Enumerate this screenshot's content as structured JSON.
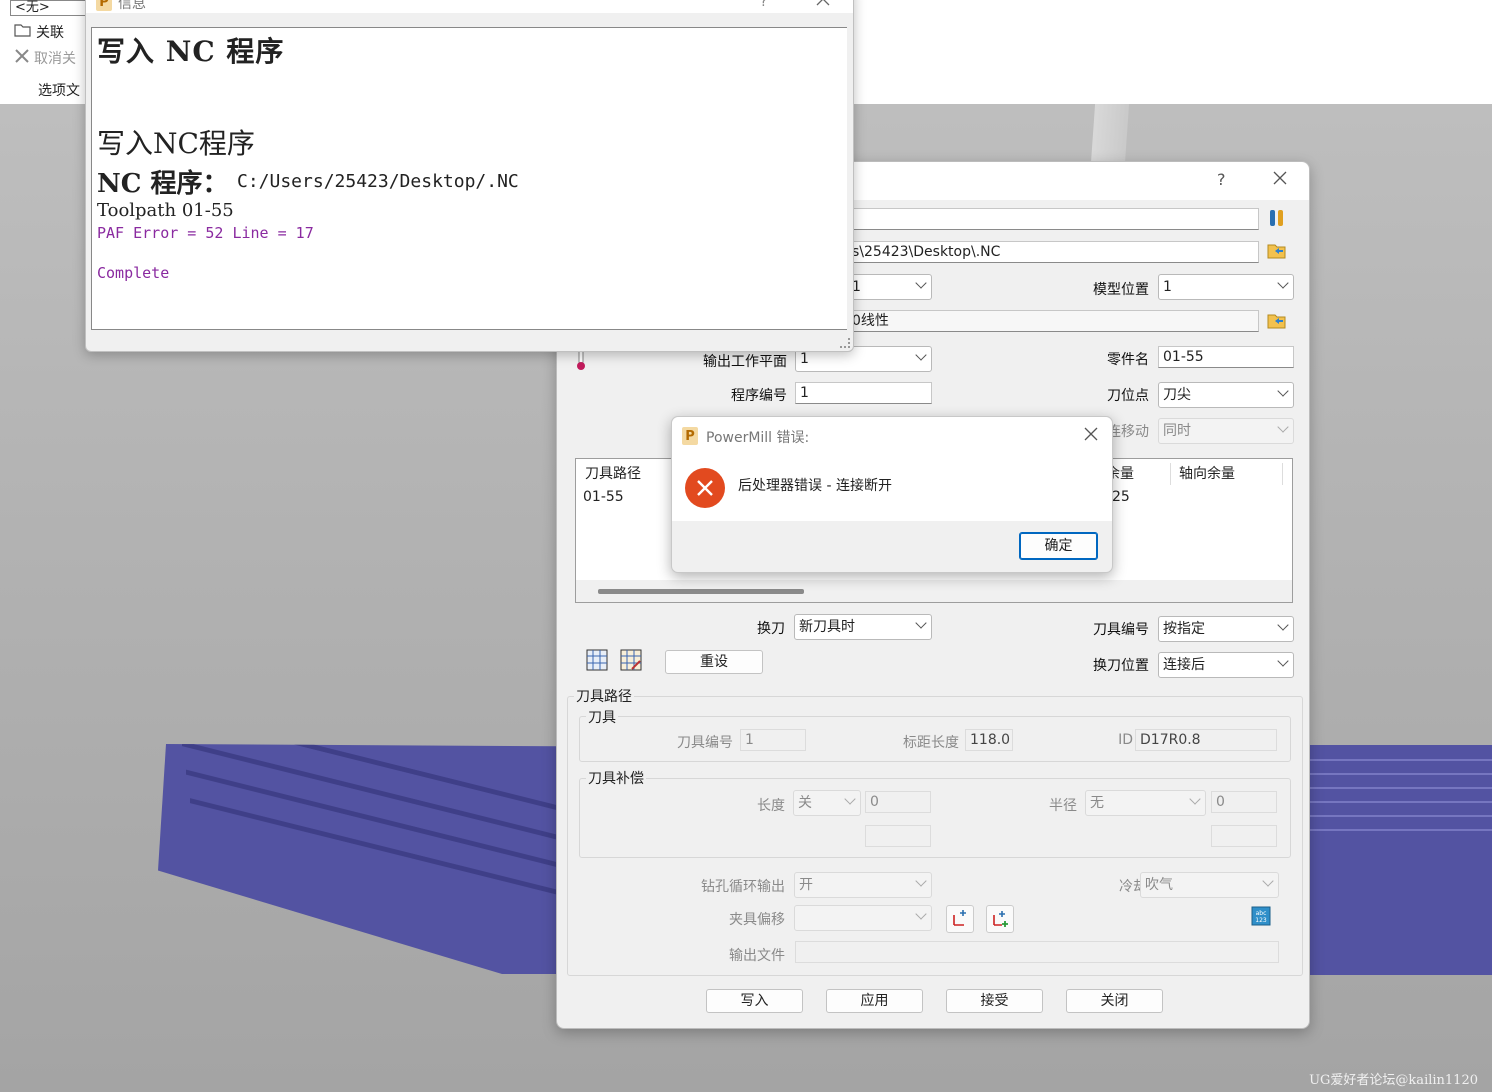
{
  "left_panel": {
    "selector": "<无>",
    "assoc": "关联",
    "unassoc": "取消关",
    "options": "选项文"
  },
  "watermark": "UG爱好者论坛@kailin1120",
  "info_window": {
    "title": "信息",
    "heading1": "写入 NC 程序",
    "heading2": "写入NC程序",
    "nc_label": "NC 程序：",
    "nc_path": "C:/Users/25423/Desktop/.NC",
    "toolpath": "Toolpath 01-55",
    "error_line": "PAF Error = 52 Line = 17",
    "complete": "Complete"
  },
  "nc_dialog": {
    "help": "?",
    "path_tail": "s\\25423\\Desktop\\.NC",
    "row3_value": "1",
    "model_pos_label": "模型位置",
    "model_pos_value": "1",
    "linear_tail": "0线性",
    "output_wp_label": "输出工作平面",
    "output_wp_value": "1",
    "part_name_label": "零件名",
    "part_name_value": "01-55",
    "program_no_label": "程序编号",
    "program_no_value": "1",
    "tool_point_label": "刀位点",
    "tool_point_value": "刀尖",
    "move_label": "连移动",
    "move_value": "同时",
    "list": {
      "col1": "刀具路径",
      "row1": "01-55",
      "col_stock": "余量",
      "col_axial": "轴向余量",
      "stock_val": "25"
    },
    "tool_change_label": "换刀",
    "tool_change_value": "新刀具时",
    "tool_no_label": "刀具编号",
    "tool_no_value": "按指定",
    "reset": "重设",
    "tc_pos_label": "换刀位置",
    "tc_pos_value": "连接后",
    "toolpath_group": "刀具路径",
    "tool_group": "刀具",
    "tool_number_label": "刀具编号",
    "tool_number_value": "1",
    "gauge_label": "标距长度",
    "gauge_value": "118.0",
    "id_label": "ID",
    "id_value": "D17R0.8",
    "comp_group": "刀具补偿",
    "length_label": "长度",
    "length_value": "关",
    "length_num": "0",
    "radius_label": "半径",
    "radius_value": "无",
    "radius_num": "0",
    "drill_label": "钻孔循环输出",
    "drill_value": "开",
    "coolant_label": "冷却",
    "coolant_value": "吹气",
    "fixture_label": "夹具偏移",
    "output_file_label": "输出文件",
    "buttons": {
      "write": "写入",
      "apply": "应用",
      "accept": "接受",
      "close": "关闭"
    }
  },
  "error_dialog": {
    "title": "PowerMill 错误:",
    "message": "后处理器错误 - 连接断开",
    "ok": "确定"
  },
  "colors": {
    "model": "#5353a2",
    "error_red": "#e24a1f",
    "accent_blue": "#0067c0"
  }
}
